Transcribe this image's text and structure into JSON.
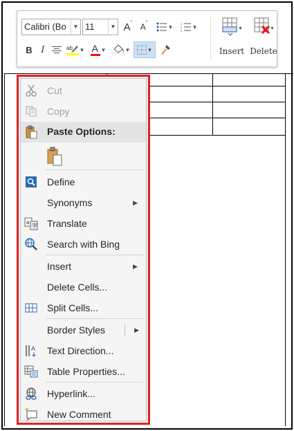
{
  "toolbar": {
    "font_name": "Calibri (Bo",
    "font_size": "11",
    "grow_font": "A",
    "shrink_font": "A",
    "bold": "B",
    "italic": "I",
    "font_color_letter": "A",
    "insert_label": "Insert",
    "delete_label": "Delete"
  },
  "menu": {
    "cut": "Cut",
    "copy": "Copy",
    "paste_options": "Paste Options:",
    "define": "Define",
    "synonyms": "Synonyms",
    "translate": "Translate",
    "search_bing": "Search with Bing",
    "insert": "Insert",
    "delete_cells": "Delete Cells...",
    "split_cells": "Split Cells...",
    "border_styles": "Border Styles",
    "text_direction": "Text Direction...",
    "table_properties": "Table Properties...",
    "hyperlink": "Hyperlink...",
    "new_comment": "New Comment"
  },
  "colors": {
    "highlight_red": "#e32020",
    "highlight_yellow": "#ffff00",
    "font_red": "#e81123",
    "accent_blue": "#2b579a"
  }
}
